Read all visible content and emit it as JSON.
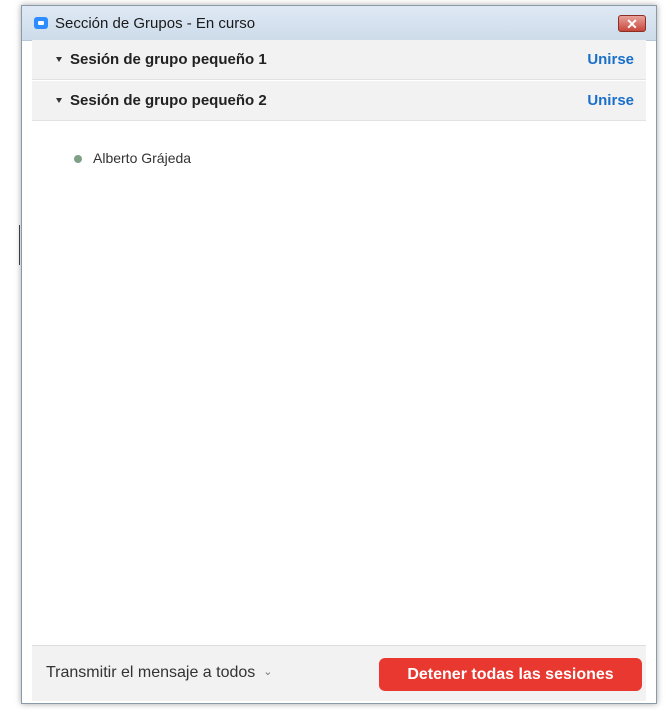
{
  "window": {
    "title": "Sección de Grupos - En curso",
    "close_label": "✕"
  },
  "groups": [
    {
      "name": "Sesión de grupo pequeño 1",
      "join_label": "Unirse",
      "expanded": true,
      "members": []
    },
    {
      "name": "Sesión de grupo pequeño 2",
      "join_label": "Unirse",
      "expanded": true,
      "members": [
        {
          "name": "Alberto Grájeda",
          "status_color": "#7f9f86"
        }
      ]
    }
  ],
  "footer": {
    "broadcast_label": "Transmitir el mensaje a todos",
    "broadcast_chevron": "⌄",
    "stop_all_label": "Detener todas las sesiones"
  },
  "colors": {
    "accent_link": "#1a6fc9",
    "danger": "#e8382f"
  }
}
